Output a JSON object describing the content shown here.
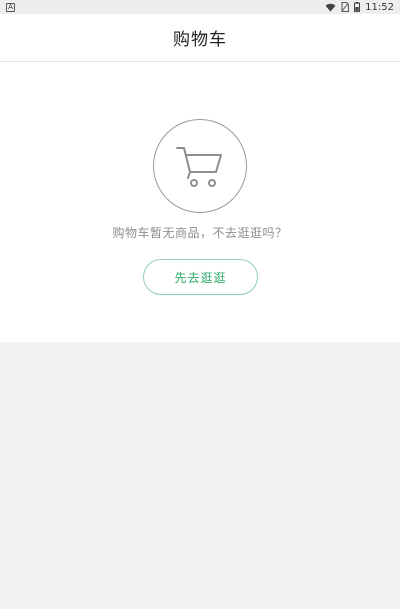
{
  "status_bar": {
    "left_icon": "notification-app-icon",
    "time": "11:52",
    "icons": [
      "wifi-icon",
      "no-sim-icon",
      "battery-icon"
    ]
  },
  "header": {
    "title": "购物车"
  },
  "empty_state": {
    "icon": "shopping-cart-icon",
    "message": "购物车暂无商品，不去逛逛吗？",
    "button_label": "先去逛逛"
  },
  "colors": {
    "accent": "#2bab6a",
    "button_border": "#8fd0ae",
    "icon_stroke": "#9a9a9a",
    "message_text": "#8c8c8c",
    "background": "#f2f2f2"
  }
}
